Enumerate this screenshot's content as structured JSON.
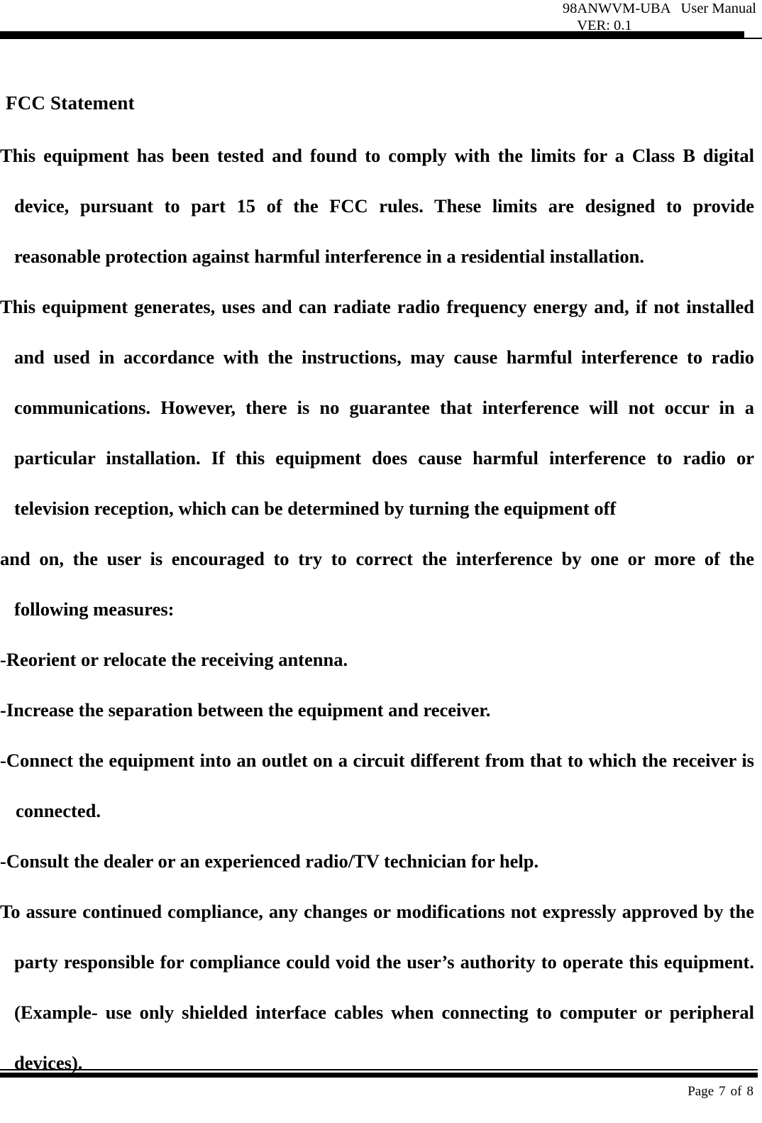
{
  "header": {
    "model": "98ANWVM-UBA",
    "doc_type": "User Manual",
    "version": "VER: 0.1"
  },
  "document": {
    "section_title": "FCC Statement",
    "paragraphs": [
      "This equipment has been tested and found to comply with the limits for a Class B digital device, pursuant to part 15 of the FCC rules. These limits are designed to provide reasonable protection against harmful interference in a residential installation.",
      "This equipment generates, uses and can radiate radio frequency energy and, if not installed and used in accordance with the instructions, may cause harmful interference to radio communications. However, there is no guarantee that interference will not occur in a particular installation. If this equipment does cause harmful interference to radio or television reception, which can be determined by turning the equipment off",
      "and on, the user is encouraged to try to correct the interference by one or more of the following measures:"
    ],
    "measures": [
      "-Reorient or relocate the receiving antenna.",
      "-Increase the separation between the equipment and receiver.",
      "-Connect the equipment into an outlet on a circuit different from that to which the receiver is connected.",
      "-Consult the dealer or an experienced radio/TV technician for help."
    ],
    "closing_paragraph": "To assure continued compliance, any changes or modifications not expressly approved by the party responsible for compliance could void the user’s authority to operate this equipment. (Example- use only shielded interface cables when connecting to computer or peripheral devices)."
  },
  "footer": {
    "page_label": "Page",
    "page_number": "7",
    "of_label": "of",
    "total_pages": "8"
  },
  "colors": {
    "text": "#000000",
    "rule": "#000000",
    "background": "#ffffff"
  }
}
